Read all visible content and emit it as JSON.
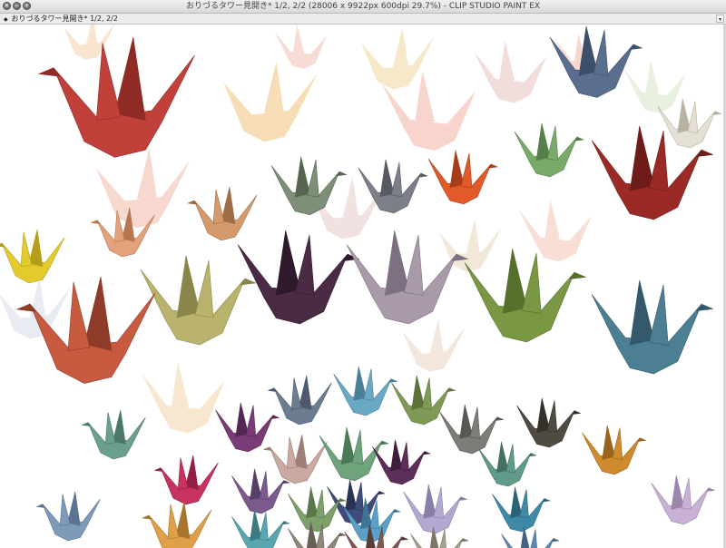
{
  "window": {
    "title": "おりづるタワー見開き* 1/2, 2/2 (28006 x 9922px 600dpi 29.7%)  - CLIP STUDIO PAINT EX",
    "close_glyph": "✕",
    "minimize_glyph": "−",
    "maximize_glyph": "+"
  },
  "tab": {
    "label": "おりづるタワー見開き* 1/2, 2/2",
    "modified_glyph": "◆",
    "menu_glyph": "▾"
  },
  "canvas": {
    "cranes": [
      {
        "color": "#c1403a",
        "accent": "#8f2a25"
      },
      {
        "color": "#5a6f8f",
        "accent": "#3c4f6b"
      },
      {
        "color": "#e5e0d6",
        "accent": "#b9b2a2"
      },
      {
        "color": "#9b2a27",
        "accent": "#6d1c1a"
      },
      {
        "color": "#e3a27c",
        "accent": "#b87550"
      },
      {
        "color": "#7aaa6a",
        "accent": "#56804b"
      },
      {
        "color": "#7e8f78",
        "accent": "#56654f"
      },
      {
        "color": "#7c7f88",
        "accent": "#575a62"
      },
      {
        "color": "#e25a2a",
        "accent": "#a83d19"
      },
      {
        "color": "#d49a6c",
        "accent": "#9e6c45"
      },
      {
        "color": "#8e8c7c",
        "accent": "#66645a"
      },
      {
        "color": "#e3cb2e",
        "accent": "#b49e1c"
      },
      {
        "color": "#b9b36d",
        "accent": "#8a8548"
      },
      {
        "color": "#4a2a45",
        "accent": "#2f1a2c"
      },
      {
        "color": "#a89aa8",
        "accent": "#7d7080"
      },
      {
        "color": "#7a9844",
        "accent": "#56702c"
      },
      {
        "color": "#4c7f93",
        "accent": "#33596a"
      },
      {
        "color": "#c85a40",
        "accent": "#8f3d2a"
      },
      {
        "color": "#6c7d92",
        "accent": "#4c5a6b"
      },
      {
        "color": "#6aa9c5",
        "accent": "#4a7f98"
      },
      {
        "color": "#7e9a56",
        "accent": "#5b7239"
      },
      {
        "color": "#6aa08c",
        "accent": "#4b7867"
      },
      {
        "color": "#7b3b76",
        "accent": "#552853"
      },
      {
        "color": "#c9a9a1",
        "accent": "#9c7f78"
      },
      {
        "color": "#6ea37c",
        "accent": "#4c7a59"
      },
      {
        "color": "#7e7c78",
        "accent": "#5a5854"
      },
      {
        "color": "#4f4a42",
        "accent": "#34302a"
      },
      {
        "color": "#d08a2e",
        "accent": "#9a631c"
      },
      {
        "color": "#c8325e",
        "accent": "#941f44"
      },
      {
        "color": "#7d5a8e",
        "accent": "#574066"
      },
      {
        "color": "#5f9a8a",
        "accent": "#446f63"
      },
      {
        "color": "#3f4b7a",
        "accent": "#2a3355"
      },
      {
        "color": "#5e2e5a",
        "accent": "#3f1e3c"
      },
      {
        "color": "#9cbf72",
        "accent": "#739450"
      },
      {
        "color": "#b3a8cf",
        "accent": "#8a7fa8"
      },
      {
        "color": "#3e8aa6",
        "accent": "#2b6479"
      },
      {
        "color": "#c9b0d6",
        "accent": "#9d86ab"
      },
      {
        "color": "#7e9ab8",
        "accent": "#5a7390"
      },
      {
        "color": "#e0a04a",
        "accent": "#a8742e"
      },
      {
        "color": "#58a6b0",
        "accent": "#3c7b83"
      },
      {
        "color": "#7ea06a",
        "accent": "#5a774a"
      },
      {
        "color": "#8f877c",
        "accent": "#676057"
      },
      {
        "color": "#5aa0c8",
        "accent": "#3e7596"
      },
      {
        "color": "#7d5a52",
        "accent": "#593e38"
      },
      {
        "color": "#a7a090",
        "accent": "#7c7568"
      },
      {
        "color": "#6f7a5e",
        "accent": "#4e5741"
      },
      {
        "color": "#5e8ab0",
        "accent": "#426482"
      }
    ],
    "faint_cranes": [
      {
        "color": "#f1c27a"
      },
      {
        "color": "#f3b4a4"
      },
      {
        "color": "#f2d7a0"
      },
      {
        "color": "#e9c2c2"
      },
      {
        "color": "#f0b9a7"
      },
      {
        "color": "#d6e6c8"
      },
      {
        "color": "#f5cfa6"
      },
      {
        "color": "#efc0b2"
      },
      {
        "color": "#e7c9c9"
      },
      {
        "color": "#f2d4a8"
      },
      {
        "color": "#d7dbe8"
      },
      {
        "color": "#f3c4b2"
      },
      {
        "color": "#e8d2c3"
      },
      {
        "color": "#f3b9a6"
      },
      {
        "color": "#e9d6b8"
      }
    ]
  }
}
